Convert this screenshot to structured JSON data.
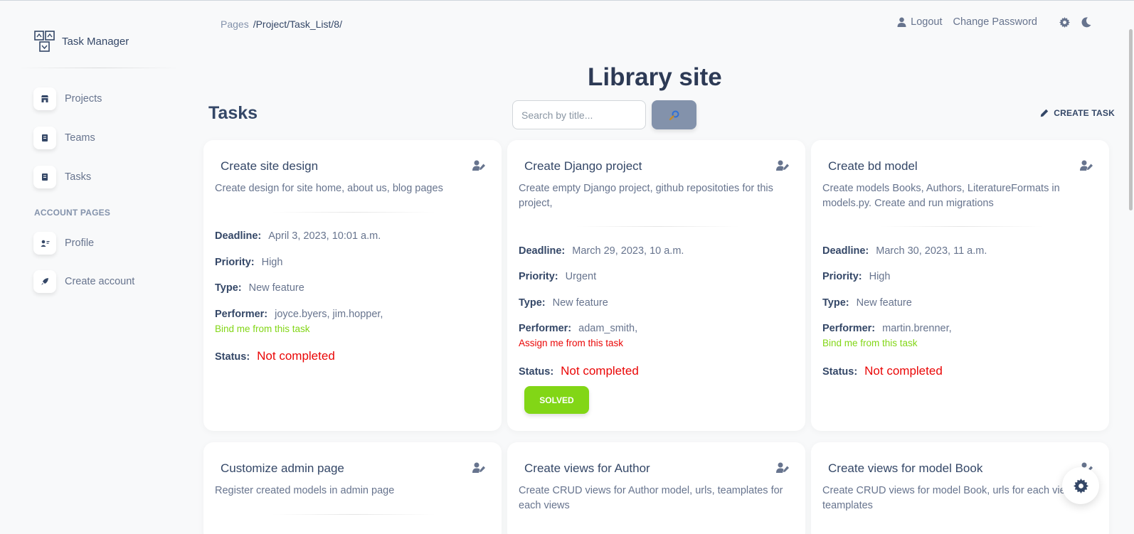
{
  "app": {
    "name": "Task Manager"
  },
  "sidebar": {
    "items": [
      {
        "label": "Projects",
        "icon": "shop-icon"
      },
      {
        "label": "Teams",
        "icon": "document-icon"
      },
      {
        "label": "Tasks",
        "icon": "document-icon"
      }
    ],
    "section_title": "ACCOUNT PAGES",
    "account_items": [
      {
        "label": "Profile",
        "icon": "user-icon"
      },
      {
        "label": "Create account",
        "icon": "rocket-icon"
      }
    ]
  },
  "breadcrumb": {
    "root": "Pages",
    "path": "/Project/Task_List/8/"
  },
  "topnav": {
    "logout": "Logout",
    "change_password": "Change Password"
  },
  "project": {
    "title": "Library site"
  },
  "tasks_heading": "Tasks",
  "search": {
    "placeholder": "Search by title...",
    "button_icon": "search-icon"
  },
  "create_task_label": "CREATE TASK",
  "tasks": [
    {
      "title": "Create site design",
      "description": "Create design for site home, about us, blog pages",
      "deadline_label": "Deadline:",
      "deadline": "April 3, 2023, 10:01 a.m.",
      "priority_label": "Priority:",
      "priority": "High",
      "type_label": "Type:",
      "type": "New feature",
      "performer_label": "Performer:",
      "performer": "joyce.byers, jim.hopper,",
      "action": "Bind me from this task",
      "action_color": "#82d616",
      "status_label": "Status:",
      "status": "Not completed"
    },
    {
      "title": "Create Django project",
      "description": "Create empty Django project, github repositoties for this project,",
      "deadline_label": "Deadline:",
      "deadline": "March 29, 2023, 10 a.m.",
      "priority_label": "Priority:",
      "priority": "Urgent",
      "type_label": "Type:",
      "type": "New feature",
      "performer_label": "Performer:",
      "performer": "adam_smith,",
      "action": "Assign me from this task",
      "action_color": "#ea0606",
      "status_label": "Status:",
      "status": "Not completed",
      "solved_label": "SOLVED"
    },
    {
      "title": "Create bd model",
      "description": "Create models Books, Authors, LiteratureFormats in models.py. Create and run migrations",
      "deadline_label": "Deadline:",
      "deadline": "March 30, 2023, 11 a.m.",
      "priority_label": "Priority:",
      "priority": "High",
      "type_label": "Type:",
      "type": "New feature",
      "performer_label": "Performer:",
      "performer": "martin.brenner,",
      "action": "Bind me from this task",
      "action_color": "#82d616",
      "status_label": "Status:",
      "status": "Not completed"
    },
    {
      "title": "Customize admin page",
      "description": "Register created models in admin page"
    },
    {
      "title": "Create views for Author",
      "description": "Create CRUD views for Author model, urls, teamplates for each views"
    },
    {
      "title": "Create views for model Book",
      "description": "Create CRUD views for model Book, urls for each views, teamplates"
    }
  ],
  "colors": {
    "status_red": "#ea0606",
    "success_green": "#82d616",
    "text_dark": "#344767",
    "text_muted": "#67748e"
  }
}
